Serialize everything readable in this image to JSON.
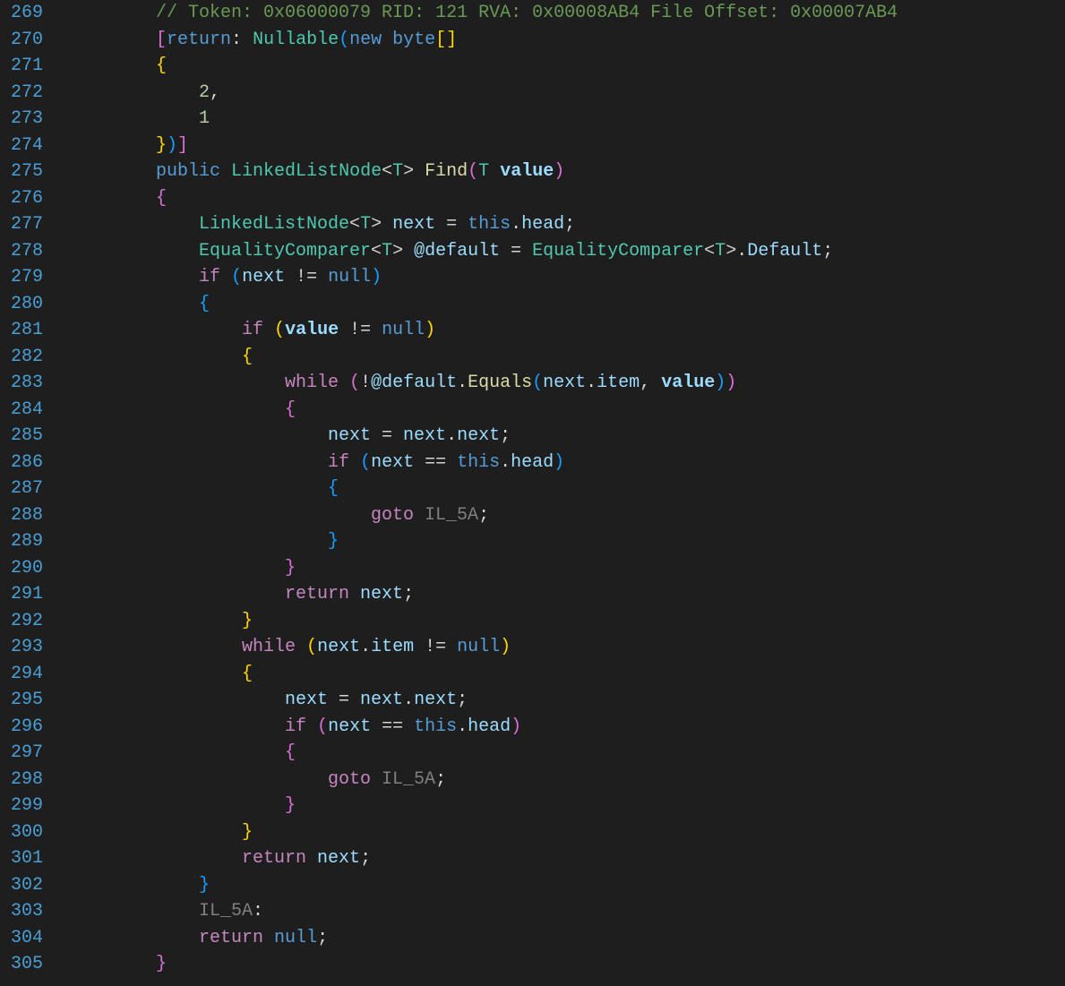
{
  "startLine": 269,
  "lines": [
    {
      "indent": 2,
      "tokens": [
        [
          "comment",
          "// Token: 0x06000079 RID: 121 RVA: 0x00008AB4 File Offset: 0x00007AB4"
        ]
      ]
    },
    {
      "indent": 2,
      "tokens": [
        [
          "brack-p",
          "["
        ],
        [
          "keyword",
          "return"
        ],
        [
          "punct",
          ": "
        ],
        [
          "type",
          "Nullable"
        ],
        [
          "paren-b",
          "("
        ],
        [
          "keyword",
          "new"
        ],
        [
          "punct",
          " "
        ],
        [
          "keyword",
          "byte"
        ],
        [
          "brack-y",
          "["
        ],
        [
          "brack-y",
          "]"
        ]
      ]
    },
    {
      "indent": 2,
      "tokens": [
        [
          "brace-y",
          "{"
        ]
      ]
    },
    {
      "indent": 3,
      "tokens": [
        [
          "num",
          "2"
        ],
        [
          "punct",
          ","
        ]
      ]
    },
    {
      "indent": 3,
      "tokens": [
        [
          "num",
          "1"
        ]
      ]
    },
    {
      "indent": 2,
      "tokens": [
        [
          "brace-y",
          "}"
        ],
        [
          "paren-b",
          ")"
        ],
        [
          "brack-p",
          "]"
        ]
      ]
    },
    {
      "indent": 2,
      "tokens": [
        [
          "keyword",
          "public"
        ],
        [
          "punct",
          " "
        ],
        [
          "type",
          "LinkedListNode"
        ],
        [
          "punct",
          "<"
        ],
        [
          "type",
          "T"
        ],
        [
          "punct",
          "> "
        ],
        [
          "method",
          "Find"
        ],
        [
          "paren-p",
          "("
        ],
        [
          "type",
          "T"
        ],
        [
          "punct",
          " "
        ],
        [
          "param",
          "value"
        ],
        [
          "paren-p",
          ")"
        ]
      ]
    },
    {
      "indent": 2,
      "tokens": [
        [
          "brace-p",
          "{"
        ]
      ]
    },
    {
      "indent": 3,
      "tokens": [
        [
          "type",
          "LinkedListNode"
        ],
        [
          "punct",
          "<"
        ],
        [
          "type",
          "T"
        ],
        [
          "punct",
          "> "
        ],
        [
          "var",
          "next"
        ],
        [
          "punct",
          " = "
        ],
        [
          "keyword",
          "this"
        ],
        [
          "punct",
          "."
        ],
        [
          "var",
          "head"
        ],
        [
          "punct",
          ";"
        ]
      ]
    },
    {
      "indent": 3,
      "tokens": [
        [
          "type",
          "EqualityComparer"
        ],
        [
          "punct",
          "<"
        ],
        [
          "type",
          "T"
        ],
        [
          "punct",
          "> "
        ],
        [
          "var",
          "@default"
        ],
        [
          "punct",
          " = "
        ],
        [
          "type",
          "EqualityComparer"
        ],
        [
          "punct",
          "<"
        ],
        [
          "type",
          "T"
        ],
        [
          "punct",
          ">."
        ],
        [
          "var",
          "Default"
        ],
        [
          "punct",
          ";"
        ]
      ]
    },
    {
      "indent": 3,
      "tokens": [
        [
          "ctrl",
          "if"
        ],
        [
          "punct",
          " "
        ],
        [
          "paren-b",
          "("
        ],
        [
          "var",
          "next"
        ],
        [
          "punct",
          " != "
        ],
        [
          "keyword",
          "null"
        ],
        [
          "paren-b",
          ")"
        ]
      ]
    },
    {
      "indent": 3,
      "tokens": [
        [
          "brace-b",
          "{"
        ]
      ]
    },
    {
      "indent": 4,
      "tokens": [
        [
          "ctrl",
          "if"
        ],
        [
          "punct",
          " "
        ],
        [
          "paren-y",
          "("
        ],
        [
          "param",
          "value"
        ],
        [
          "punct",
          " != "
        ],
        [
          "keyword",
          "null"
        ],
        [
          "paren-y",
          ")"
        ]
      ]
    },
    {
      "indent": 4,
      "tokens": [
        [
          "brace-y",
          "{"
        ]
      ]
    },
    {
      "indent": 5,
      "tokens": [
        [
          "ctrl",
          "while"
        ],
        [
          "punct",
          " "
        ],
        [
          "paren-p",
          "("
        ],
        [
          "punct",
          "!"
        ],
        [
          "var",
          "@default"
        ],
        [
          "punct",
          "."
        ],
        [
          "method",
          "Equals"
        ],
        [
          "paren-b",
          "("
        ],
        [
          "var",
          "next"
        ],
        [
          "punct",
          "."
        ],
        [
          "var",
          "item"
        ],
        [
          "punct",
          ", "
        ],
        [
          "param",
          "value"
        ],
        [
          "paren-b",
          ")"
        ],
        [
          "paren-p",
          ")"
        ]
      ]
    },
    {
      "indent": 5,
      "tokens": [
        [
          "brace-p",
          "{"
        ]
      ]
    },
    {
      "indent": 6,
      "tokens": [
        [
          "var",
          "next"
        ],
        [
          "punct",
          " = "
        ],
        [
          "var",
          "next"
        ],
        [
          "punct",
          "."
        ],
        [
          "var",
          "next"
        ],
        [
          "punct",
          ";"
        ]
      ]
    },
    {
      "indent": 6,
      "tokens": [
        [
          "ctrl",
          "if"
        ],
        [
          "punct",
          " "
        ],
        [
          "paren-b",
          "("
        ],
        [
          "var",
          "next"
        ],
        [
          "punct",
          " == "
        ],
        [
          "keyword",
          "this"
        ],
        [
          "punct",
          "."
        ],
        [
          "var",
          "head"
        ],
        [
          "paren-b",
          ")"
        ]
      ]
    },
    {
      "indent": 6,
      "tokens": [
        [
          "brace-b",
          "{"
        ]
      ]
    },
    {
      "indent": 7,
      "tokens": [
        [
          "ctrl",
          "goto"
        ],
        [
          "punct",
          " "
        ],
        [
          "dim",
          "IL_5A"
        ],
        [
          "punct",
          ";"
        ]
      ]
    },
    {
      "indent": 6,
      "tokens": [
        [
          "brace-b",
          "}"
        ]
      ]
    },
    {
      "indent": 5,
      "tokens": [
        [
          "brace-p",
          "}"
        ]
      ]
    },
    {
      "indent": 5,
      "tokens": [
        [
          "ctrl",
          "return"
        ],
        [
          "punct",
          " "
        ],
        [
          "var",
          "next"
        ],
        [
          "punct",
          ";"
        ]
      ]
    },
    {
      "indent": 4,
      "tokens": [
        [
          "brace-y",
          "}"
        ]
      ]
    },
    {
      "indent": 4,
      "tokens": [
        [
          "ctrl",
          "while"
        ],
        [
          "punct",
          " "
        ],
        [
          "paren-y",
          "("
        ],
        [
          "var",
          "next"
        ],
        [
          "punct",
          "."
        ],
        [
          "var",
          "item"
        ],
        [
          "punct",
          " != "
        ],
        [
          "keyword",
          "null"
        ],
        [
          "paren-y",
          ")"
        ]
      ]
    },
    {
      "indent": 4,
      "tokens": [
        [
          "brace-y",
          "{"
        ]
      ]
    },
    {
      "indent": 5,
      "tokens": [
        [
          "var",
          "next"
        ],
        [
          "punct",
          " = "
        ],
        [
          "var",
          "next"
        ],
        [
          "punct",
          "."
        ],
        [
          "var",
          "next"
        ],
        [
          "punct",
          ";"
        ]
      ]
    },
    {
      "indent": 5,
      "tokens": [
        [
          "ctrl",
          "if"
        ],
        [
          "punct",
          " "
        ],
        [
          "paren-p",
          "("
        ],
        [
          "var",
          "next"
        ],
        [
          "punct",
          " == "
        ],
        [
          "keyword",
          "this"
        ],
        [
          "punct",
          "."
        ],
        [
          "var",
          "head"
        ],
        [
          "paren-p",
          ")"
        ]
      ]
    },
    {
      "indent": 5,
      "tokens": [
        [
          "brace-p",
          "{"
        ]
      ]
    },
    {
      "indent": 6,
      "tokens": [
        [
          "ctrl",
          "goto"
        ],
        [
          "punct",
          " "
        ],
        [
          "dim",
          "IL_5A"
        ],
        [
          "punct",
          ";"
        ]
      ]
    },
    {
      "indent": 5,
      "tokens": [
        [
          "brace-p",
          "}"
        ]
      ]
    },
    {
      "indent": 4,
      "tokens": [
        [
          "brace-y",
          "}"
        ]
      ]
    },
    {
      "indent": 4,
      "tokens": [
        [
          "ctrl",
          "return"
        ],
        [
          "punct",
          " "
        ],
        [
          "var",
          "next"
        ],
        [
          "punct",
          ";"
        ]
      ]
    },
    {
      "indent": 3,
      "tokens": [
        [
          "brace-b",
          "}"
        ]
      ]
    },
    {
      "indent": 3,
      "tokens": [
        [
          "dim",
          "IL_5A"
        ],
        [
          "punct",
          ":"
        ]
      ]
    },
    {
      "indent": 3,
      "tokens": [
        [
          "ctrl",
          "return"
        ],
        [
          "punct",
          " "
        ],
        [
          "keyword",
          "null"
        ],
        [
          "punct",
          ";"
        ]
      ]
    },
    {
      "indent": 2,
      "tokens": [
        [
          "brace-p",
          "}"
        ]
      ]
    }
  ]
}
